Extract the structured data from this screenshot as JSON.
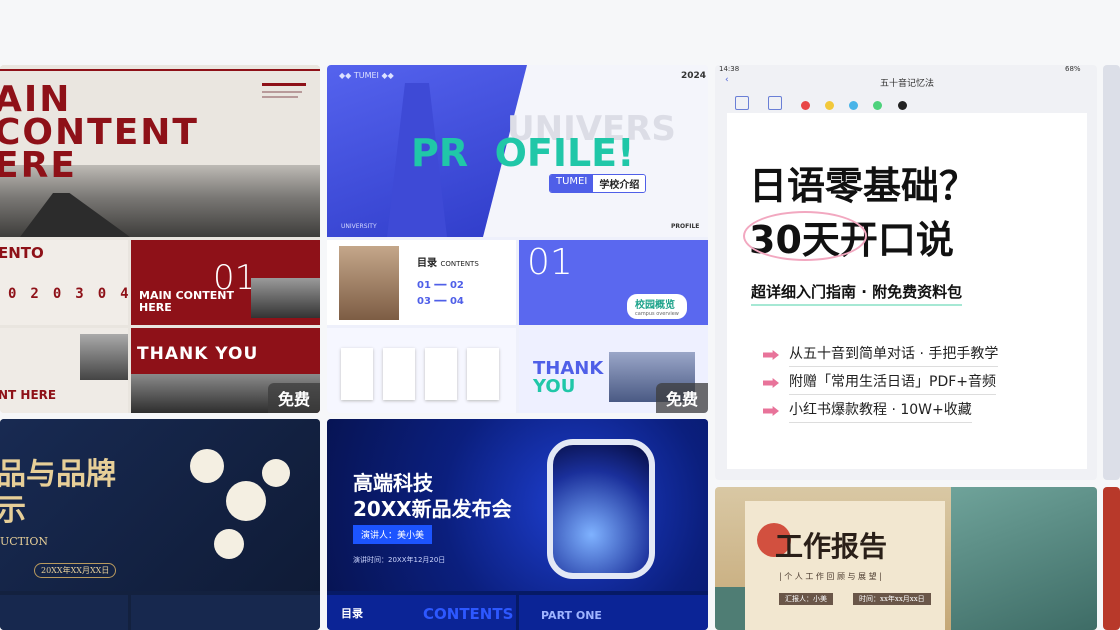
{
  "cards": {
    "c1": {
      "hero_line1": "AIN",
      "hero_line2": "CONTENT",
      "hero_line3": "ERE",
      "slide_b_title": "ENTO",
      "slide_c_num": "01",
      "slide_c_text": "MAIN CONTENT HERE",
      "slide_d_text": "NT HERE",
      "slide_e_text": "THANK YOU",
      "badge": "免费"
    },
    "c2": {
      "tag_left": "◆◆ TUMEI ◆◆",
      "year": "2024",
      "big": "PR  OFILE!",
      "univ": "UNIVERS",
      "pill_brand": "TUMEI",
      "pill_text": "学校介绍",
      "footer_left": "UNIVERSITY",
      "footer_right": "PROFILE",
      "toc_title": "目录",
      "toc_sub": "CONTENTS",
      "toc_items": [
        "01",
        "02",
        "03",
        "04"
      ],
      "slide_num": "01",
      "slide_label": "校园概览",
      "slide_label_en": "campus overview",
      "thanks_1": "THANK",
      "thanks_2": "YOU",
      "badge": "免费"
    },
    "c3": {
      "status_time": "14:38",
      "status_battery": "68%",
      "note_title": "五十音记忆法",
      "title_1": "日语零基础？",
      "title_2": "30天开口说",
      "subtitle": "超详细入门指南 · 附免费资料包",
      "bullets": [
        "从五十音到简单对话 · 手把手教学",
        "附赠「常用生活日语」PDF+音频",
        "小红书爆款教程 · 10W+收藏"
      ]
    },
    "c4": {
      "title": "品与品牌",
      "title_2": "示",
      "sub": "UCTION",
      "date": "20XX年XX月XX日"
    },
    "c5": {
      "title_1": "高端科技",
      "title_2": "20XX新品发布会",
      "speaker": "演讲人：美小美",
      "date": "演讲时间：20XX年12月20日",
      "contents_cn": "目录",
      "contents_en": "CONTENTS",
      "part": "PART ONE"
    },
    "c6": {
      "title": "工作报告",
      "sub": "| 个 人 工 作 回 顾 与 展 望 |",
      "presenter": "汇报人：小美",
      "time": "时间：xx年xx月xx日"
    }
  },
  "colors": {
    "dark_red": "#8e1118",
    "blue_brand": "#4f5fe8",
    "navy": "#14234a",
    "tech_blue": "#0a1f7a",
    "pink_accent": "#e8739a"
  }
}
